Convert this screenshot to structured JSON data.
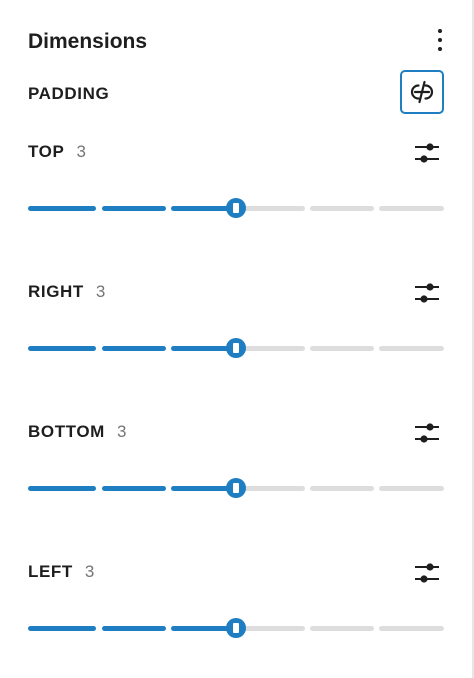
{
  "panel": {
    "title": "Dimensions",
    "options_icon": "more-vertical-icon",
    "section_label": "PADDING",
    "unlink_icon": "unlink-sides-icon",
    "accent_color": "#1f7ec1",
    "track_color": "#dddddd"
  },
  "sides": [
    {
      "label": "TOP",
      "value": "3",
      "slider_step": 3,
      "slider_steps_total": 6,
      "custom_icon": "settings-sliders-icon"
    },
    {
      "label": "RIGHT",
      "value": "3",
      "slider_step": 3,
      "slider_steps_total": 6,
      "custom_icon": "settings-sliders-icon"
    },
    {
      "label": "BOTTOM",
      "value": "3",
      "slider_step": 3,
      "slider_steps_total": 6,
      "custom_icon": "settings-sliders-icon"
    },
    {
      "label": "LEFT",
      "value": "3",
      "slider_step": 3,
      "slider_steps_total": 6,
      "custom_icon": "settings-sliders-icon"
    }
  ]
}
